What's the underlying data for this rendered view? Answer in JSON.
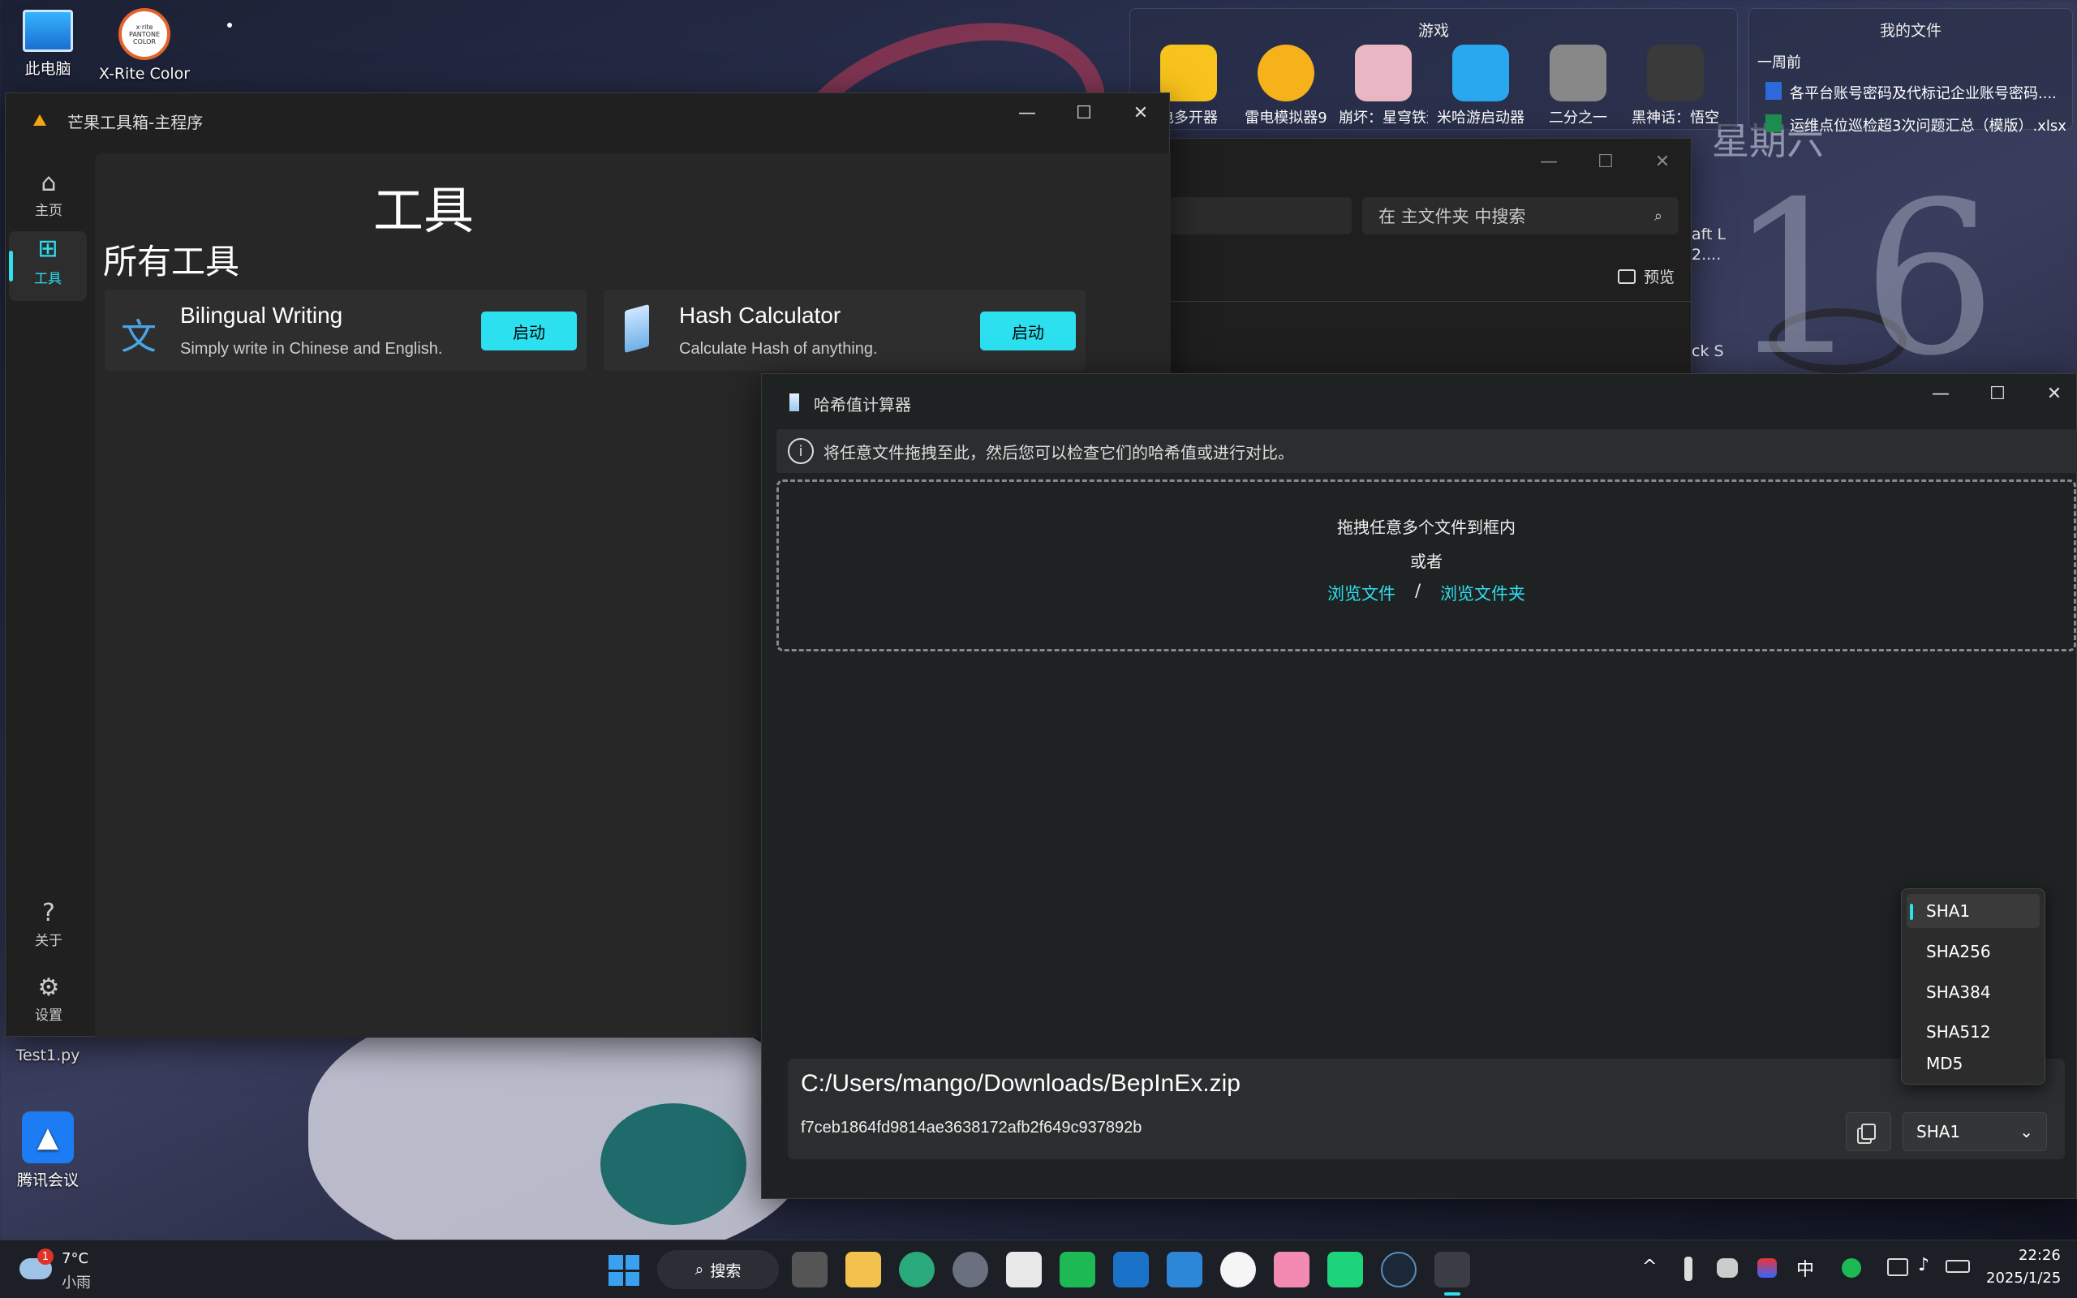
{
  "desktop": {
    "icons": [
      {
        "label": "此电脑"
      },
      {
        "label": "X-Rite Color"
      },
      {
        "label": "Test1.py"
      },
      {
        "label": "腾讯会议"
      }
    ],
    "xrite_logo": "x·rite PANTONE COLOR",
    "date_widget": {
      "weekday": "星期六",
      "day": "16"
    }
  },
  "games_panel": {
    "title": "游戏",
    "items": [
      "电多开器",
      "雷电模拟器9",
      "崩坏：星穹铁道",
      "米哈游启动器",
      "二分之一",
      "黑神话：悟空"
    ]
  },
  "files_panel": {
    "title": "我的文件",
    "section": "一周前",
    "files": [
      "各平台账号密码及代标记企业账号密码....",
      "运维点位巡检超3次问题汇总（模版）.xlsx"
    ]
  },
  "explorer": {
    "search_placeholder": "在 主文件夹 中搜索",
    "more": "...",
    "preview": "预览",
    "peek_items": [
      "aft L",
      "2....",
      "ck S"
    ]
  },
  "main_window": {
    "title": "芒果工具箱-主程序",
    "heading": "工具",
    "section": "所有工具",
    "nav": [
      {
        "label": "主页"
      },
      {
        "label": "工具"
      }
    ],
    "nav_bottom": [
      {
        "label": "关于"
      },
      {
        "label": "设置"
      }
    ],
    "tools": [
      {
        "name": "Bilingual Writing",
        "desc": "Simply write in Chinese and English.",
        "button": "启动"
      },
      {
        "name": "Hash Calculator",
        "desc": "Calculate Hash of anything.",
        "button": "启动"
      }
    ]
  },
  "hash_window": {
    "title": "哈希值计算器",
    "info": "将任意文件拖拽至此，然后您可以检查它们的哈希值或进行对比。",
    "drop_text": "拖拽任意多个文件到框内",
    "or": "或者",
    "browse_file": "浏览文件",
    "separator": "/",
    "browse_folder": "浏览文件夹",
    "result": {
      "path": "C:/Users/mango/Downloads/BepInEx.zip",
      "hash": "f7ceb1864fd9814ae3638172afb2f649c937892b",
      "algorithm": "SHA1"
    },
    "algorithms": [
      "SHA1",
      "SHA256",
      "SHA384",
      "SHA512",
      "MD5"
    ]
  },
  "taskbar": {
    "weather_temp": "7°C",
    "weather_desc": "小雨",
    "weather_badge": "1",
    "search": "搜索",
    "ime": "中",
    "time": "22:26",
    "date": "2025/1/25"
  },
  "colors": {
    "accent": "#2ce0f0",
    "window_bg": "#202020",
    "content_bg": "#272727"
  }
}
